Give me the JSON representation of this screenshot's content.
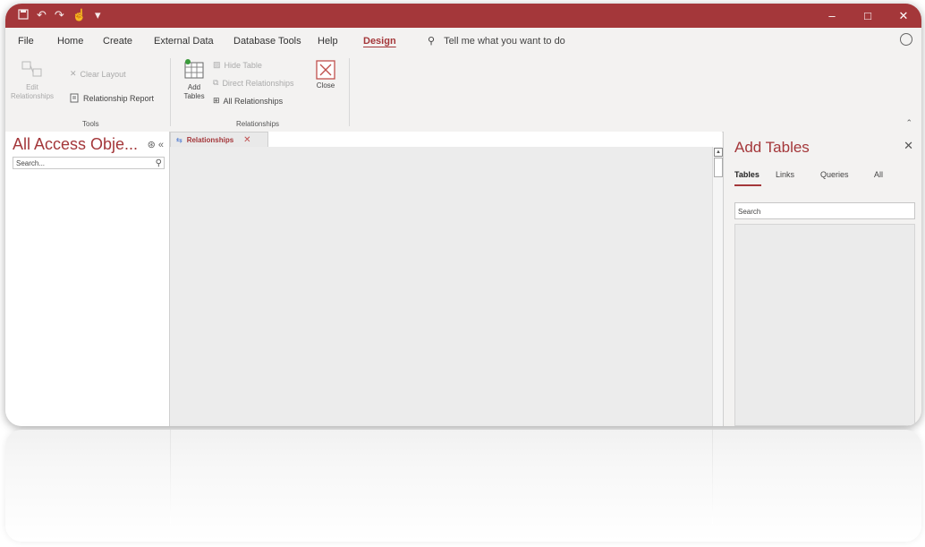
{
  "titlebar": {
    "qat": [
      "save-icon",
      "undo-icon",
      "redo-icon",
      "touch-icon",
      "customize-icon"
    ],
    "window_controls": [
      "–",
      "□",
      "✕"
    ]
  },
  "menu": {
    "items": [
      "File",
      "Home",
      "Create",
      "External Data",
      "Database Tools",
      "Help",
      "Design"
    ],
    "active": "Design",
    "tell_me": "Tell me what you want to do"
  },
  "ribbon": {
    "tools": {
      "edit_relationships": "Edit Relationships",
      "clear_layout": "Clear Layout",
      "relationship_report": "Relationship Report",
      "group_label": "Tools"
    },
    "relationships": {
      "add_tables": "Add Tables",
      "hide_table": "Hide Table",
      "direct_relationships": "Direct Relationships",
      "all_relationships": "All Relationships",
      "close": "Close",
      "group_label": "Relationships"
    }
  },
  "nav_pane": {
    "title": "All Access Obje...",
    "search_placeholder": "Search..."
  },
  "document": {
    "tab_label": "Relationships"
  },
  "add_tables_pane": {
    "title": "Add Tables",
    "tabs": [
      "Tables",
      "Links",
      "Queries",
      "All"
    ],
    "active_tab": "Tables",
    "search_placeholder": "Search"
  },
  "colors": {
    "accent": "#a4373a",
    "ribbon_bg": "#f3f2f1",
    "canvas_bg": "#ececec"
  }
}
